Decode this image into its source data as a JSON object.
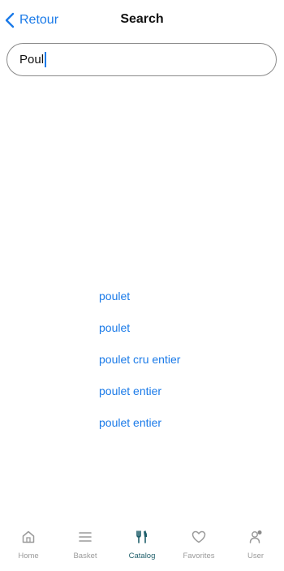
{
  "navbar": {
    "back_label": "Retour",
    "title": "Search"
  },
  "search": {
    "value": "Poul"
  },
  "suggestions": [
    "poulet",
    "poulet",
    "poulet cru entier",
    "poulet entier",
    "poulet entier"
  ],
  "tabbar": {
    "tabs": [
      {
        "label": "Home",
        "icon": "home-icon"
      },
      {
        "label": "Basket",
        "icon": "list-icon"
      },
      {
        "label": "Catalog",
        "icon": "fork-knife-icon",
        "active": true
      },
      {
        "label": "Favorites",
        "icon": "heart-icon"
      },
      {
        "label": "User",
        "icon": "user-icon"
      }
    ]
  },
  "colors": {
    "accent": "#1a7ae8",
    "active_tab": "#1f5f6b",
    "inactive_tab": "#9a9a9a"
  }
}
